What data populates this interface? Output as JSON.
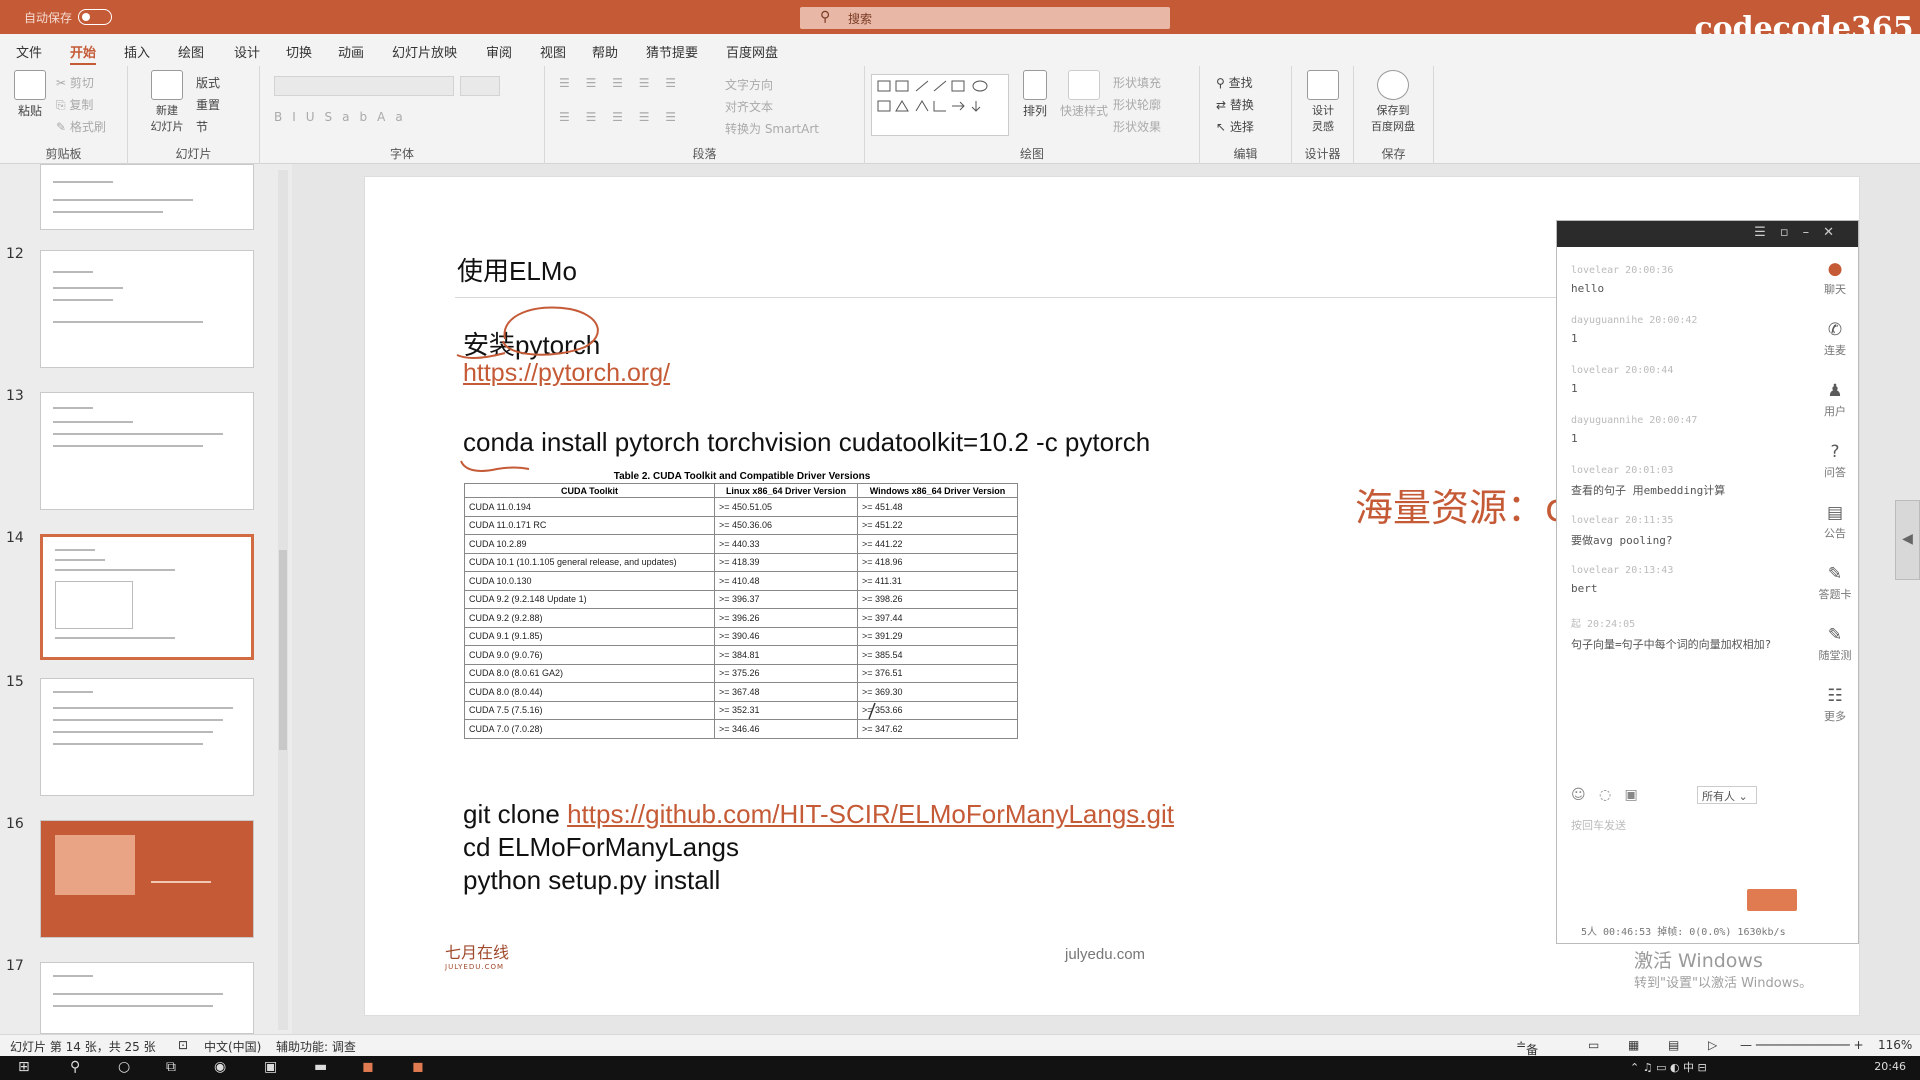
{
  "window": {
    "title": "",
    "search_placeholder": "搜索",
    "brand": "codecode365"
  },
  "tabs": [
    "文件",
    "开始",
    "插入",
    "绘图",
    "设计",
    "切换",
    "动画",
    "幻灯片放映",
    "审阅",
    "视图",
    "帮助",
    "猜节提要",
    "百度网盘"
  ],
  "ribbon": {
    "paste": "粘贴",
    "new_slide": "新建\n幻灯片",
    "layout": "版式",
    "reset": "重置",
    "section": "节",
    "arrange": "排列",
    "quick_styles": "快速样式",
    "find": "查找",
    "replace": "替换",
    "select": "选择",
    "designer": "设计\n灵感",
    "save_baidu": "保存到\n百度网盘",
    "groups": [
      "剪贴板",
      "幻灯片",
      "字体",
      "段落",
      "绘图",
      "编辑",
      "设计器",
      "保存"
    ]
  },
  "thumbnails": {
    "numbers": [
      "12",
      "13",
      "14",
      "15",
      "16",
      "17"
    ]
  },
  "slide": {
    "title": "使用ELMo",
    "install": "安装pytorch",
    "link1": "https://pytorch.org/",
    "conda": "conda install pytorch torchvision cudatoolkit=10.2 -c pytorch",
    "table_caption": "Table 2. CUDA Toolkit and Compatible Driver Versions",
    "table_headers": [
      "CUDA Toolkit",
      "Linux x86_64 Driver Version",
      "Windows x86_64 Driver Version"
    ],
    "table_rows": [
      [
        "CUDA 11.0.194",
        ">= 450.51.05",
        ">= 451.48"
      ],
      [
        "CUDA 11.0.171 RC",
        ">= 450.36.06",
        ">= 451.22"
      ],
      [
        "CUDA 10.2.89",
        ">= 440.33",
        ">= 441.22"
      ],
      [
        "CUDA 10.1 (10.1.105 general release, and updates)",
        ">= 418.39",
        ">= 418.96"
      ],
      [
        "CUDA 10.0.130",
        ">= 410.48",
        ">= 411.31"
      ],
      [
        "CUDA 9.2 (9.2.148 Update 1)",
        ">= 396.37",
        ">= 398.26"
      ],
      [
        "CUDA 9.2 (9.2.88)",
        ">= 396.26",
        ">= 397.44"
      ],
      [
        "CUDA 9.1 (9.1.85)",
        ">= 390.46",
        ">= 391.29"
      ],
      [
        "CUDA 9.0 (9.0.76)",
        ">= 384.81",
        ">= 385.54"
      ],
      [
        "CUDA 8.0 (8.0.61 GA2)",
        ">= 375.26",
        ">= 376.51"
      ],
      [
        "CUDA 8.0 (8.0.44)",
        ">= 367.48",
        ">= 369.30"
      ],
      [
        "CUDA 7.5 (7.5.16)",
        ">= 352.31",
        ">= 353.66"
      ],
      [
        "CUDA 7.0 (7.0.28)",
        ">= 346.46",
        ">= 347.62"
      ]
    ],
    "git_prefix": "git clone ",
    "git_link": "https://github.com/HIT-SCIR/ELMoForManyLangs.git",
    "cd": "cd ELMoForManyLangs",
    "python": "python setup.py install",
    "resource": "海量资源：codecode365",
    "footer": "julyedu.com",
    "logo": "七月在线",
    "logo_sub": "JULYEDU.COM"
  },
  "chat": {
    "messages": [
      {
        "user": "lovelear 20:00:36",
        "text": "hello"
      },
      {
        "user": "dayuguannihe 20:00:42",
        "text": "1"
      },
      {
        "user": "lovelear 20:00:44",
        "text": "1"
      },
      {
        "user": "dayuguannihe 20:00:47",
        "text": "1"
      },
      {
        "user": "lovelear 20:01:03",
        "text": "查看的句子  用embedding计算"
      },
      {
        "user": "lovelear 20:11:35",
        "text": "要做avg  pooling?"
      },
      {
        "user": "lovelear 20:13:43",
        "text": "bert"
      },
      {
        "user": "起 20:24:05",
        "text": "句子向量=句子中每个词的向量加权相加?"
      }
    ],
    "side": [
      "聊天",
      "连麦",
      "用户",
      "问答",
      "公告",
      "答题卡",
      "随堂测",
      "更多"
    ],
    "recipient": "所有人",
    "placeholder": "按回车发送",
    "status": "5人   00:46:53   掉帧: 0(0.0%) 1630kb/s"
  },
  "activate": {
    "line1": "激活 Windows",
    "line2": "转到\"设置\"以激活 Windows。"
  },
  "statusbar": {
    "slide_info": "幻灯片 第 14 张，共 25 张",
    "lang": "中文(中国)",
    "accessibility": "辅助功能: 调查",
    "notes": "备注",
    "zoom": "116%"
  },
  "taskbar": {
    "time": "20:46"
  },
  "colors": {
    "accent": "#c55a36"
  }
}
